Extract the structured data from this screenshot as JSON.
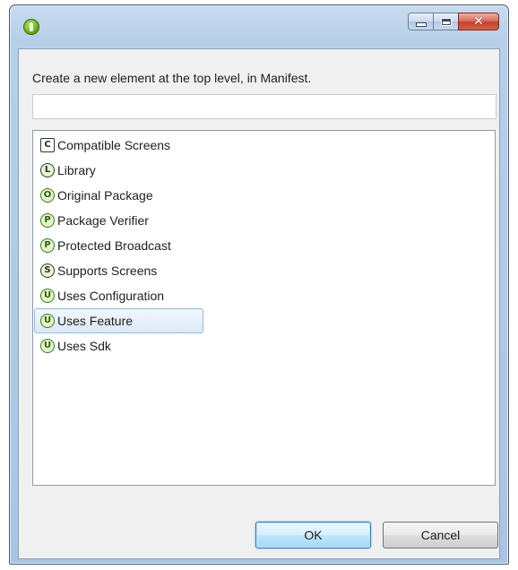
{
  "dialog": {
    "prompt": "Create a new element at the top level, in Manifest.",
    "filter_value": "",
    "items": [
      {
        "letter": "C",
        "label": "Compatible Screens",
        "icon": "compatible-screens-icon",
        "style": "square"
      },
      {
        "letter": "L",
        "label": "Library",
        "icon": "library-icon",
        "style": "circle"
      },
      {
        "letter": "O",
        "label": "Original Package",
        "icon": "original-package-icon",
        "style": "green"
      },
      {
        "letter": "P",
        "label": "Package Verifier",
        "icon": "package-verifier-icon",
        "style": "green"
      },
      {
        "letter": "P",
        "label": "Protected Broadcast",
        "icon": "protected-broadcast-icon",
        "style": "green"
      },
      {
        "letter": "S",
        "label": "Supports Screens",
        "icon": "supports-screens-icon",
        "style": "circle"
      },
      {
        "letter": "U",
        "label": "Uses Configuration",
        "icon": "uses-configuration-icon",
        "style": "green"
      },
      {
        "letter": "U",
        "label": "Uses Feature",
        "icon": "uses-feature-icon",
        "style": "green"
      },
      {
        "letter": "U",
        "label": "Uses Sdk",
        "icon": "uses-sdk-icon",
        "style": "green"
      }
    ],
    "selected_index": 7,
    "ok_label": "OK",
    "cancel_label": "Cancel"
  },
  "titlebar": {
    "app_icon": "android-plugin-icon",
    "close_glyph": "✕",
    "minimize_icon": "minimize-icon",
    "maximize_icon": "maximize-icon"
  },
  "colors": {
    "window_frame": "#a9c4e2",
    "client_background": "#f0f0f0",
    "selection": "#dbe8f8",
    "default_button": "#bee6fd"
  }
}
